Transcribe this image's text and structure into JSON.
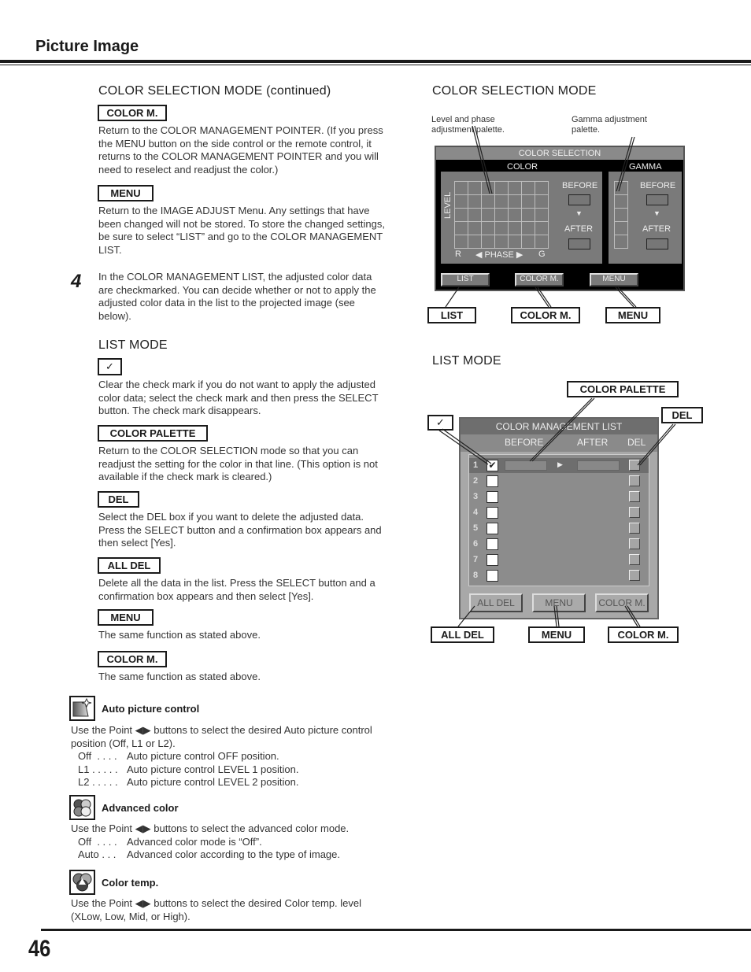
{
  "header": {
    "title": "Picture Image"
  },
  "left": {
    "heading_continued": "COLOR SELECTION MODE (continued)",
    "items": [
      {
        "label": "COLOR M.",
        "text": "Return to the COLOR MANAGEMENT POINTER. (If you press the MENU button on the side control or the remote control, it returns to the COLOR MANAGEMENT POINTER and you will need to reselect and readjust the color.)"
      },
      {
        "label": "MENU",
        "text": "Return to the IMAGE ADJUST Menu. Any settings that have been changed will not be stored. To store the changed settings, be sure to select “LIST” and go to the COLOR MANAGEMENT LIST."
      }
    ],
    "step4": {
      "number": "4",
      "text": "In the COLOR MANAGEMENT LIST, the adjusted color data are checkmarked. You can decide whether or not to apply the adjusted color data in the list to the projected image (see below)."
    },
    "list_mode_heading": "LIST MODE",
    "list_items": [
      {
        "label": "✓",
        "text": "Clear the check mark if you do not want to apply the adjusted color data; select the check mark and then press the SELECT button. The check mark disappears."
      },
      {
        "label": "COLOR PALETTE",
        "text": "Return to the COLOR SELECTION mode so that you can readjust the setting for the color in that line. (This option is not available if the check mark is cleared.)"
      },
      {
        "label": "DEL",
        "text": "Select the DEL box if you want to delete the adjusted data. Press the SELECT button and a confirmation box appears and then select [Yes]."
      },
      {
        "label": "ALL DEL",
        "text": "Delete all the data in the list. Press the SELECT button and a confirmation box appears and then select [Yes]."
      },
      {
        "label": "MENU",
        "text": "The same function as stated above."
      },
      {
        "label": "COLOR M.",
        "text": "The same function as stated above."
      }
    ],
    "features": [
      {
        "icon": "auto-picture-icon",
        "title": "Auto picture control",
        "text": "Use the Point ◀▶ buttons to select the desired Auto picture control position (Off, L1 or L2).",
        "options": [
          {
            "key": "Off  . . . .",
            "desc": "Auto picture control OFF position."
          },
          {
            "key": "L1 . . . . .",
            "desc": "Auto picture control LEVEL 1 position."
          },
          {
            "key": "L2 . . . . .",
            "desc": "Auto picture control LEVEL 2 position."
          }
        ]
      },
      {
        "icon": "advanced-color-icon",
        "title": "Advanced color",
        "text": "Use the Point ◀▶ buttons to select the advanced color mode.",
        "options": [
          {
            "key": "Off  . . . .",
            "desc": "Advanced color mode is “Off”."
          },
          {
            "key": "Auto . . .",
            "desc": "Advanced color according to the type of image."
          }
        ]
      },
      {
        "icon": "color-temp-icon",
        "title": "Color temp.",
        "text": "Use the Point ◀▶ buttons to select the desired Color temp. level (XLow, Low, Mid, or High).",
        "options": []
      }
    ]
  },
  "right": {
    "color_selection": {
      "heading": "COLOR SELECTION MODE",
      "annot_level": "Level and phase adjustment palette.",
      "annot_gamma": "Gamma adjustment palette.",
      "osd_title": "COLOR SELECTION",
      "color_label": "COLOR",
      "gamma_label": "GAMMA",
      "level_label": "LEVEL",
      "r_label": "R",
      "phase_label": "◀ PHASE ▶",
      "g_label": "G",
      "before": "BEFORE",
      "after": "AFTER",
      "buttons": [
        "LIST",
        "COLOR M.",
        "MENU"
      ],
      "callouts": [
        "LIST",
        "COLOR M.",
        "MENU"
      ]
    },
    "list_mode": {
      "heading": "LIST MODE",
      "osd_title": "COLOR MANAGEMENT LIST",
      "col_before": "BEFORE",
      "col_after": "AFTER",
      "col_del": "DEL",
      "rows": [
        {
          "num": "1",
          "checked": true
        },
        {
          "num": "2",
          "checked": false
        },
        {
          "num": "3",
          "checked": false
        },
        {
          "num": "4",
          "checked": false
        },
        {
          "num": "5",
          "checked": false
        },
        {
          "num": "6",
          "checked": false
        },
        {
          "num": "7",
          "checked": false
        },
        {
          "num": "8",
          "checked": false
        }
      ],
      "buttons": [
        "ALL DEL",
        "MENU",
        "COLOR M."
      ],
      "callout_palette": "COLOR PALETTE",
      "callout_del": "DEL",
      "callout_check": "✓",
      "callouts_bottom": [
        "ALL DEL",
        "MENU",
        "COLOR M."
      ]
    }
  },
  "footer": {
    "page_number": "46"
  }
}
